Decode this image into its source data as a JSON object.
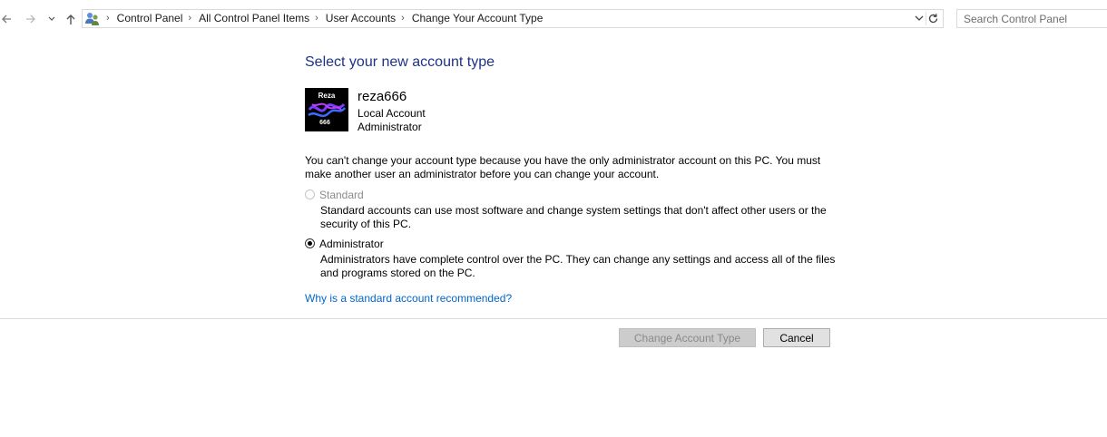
{
  "navigation": {
    "breadcrumbs": [
      "Control Panel",
      "All Control Panel Items",
      "User Accounts",
      "Change Your Account Type"
    ],
    "search": {
      "placeholder": "Search Control Panel",
      "value": ""
    }
  },
  "page": {
    "title": "Select your new account type",
    "account": {
      "name": "reza666",
      "type": "Local Account",
      "role": "Administrator",
      "avatar_text_top": "Reza",
      "avatar_text_bottom": "666"
    },
    "info": "You can't change your account type because you have the only administrator account on this PC. You must make another user an administrator before you can change your account.",
    "options": [
      {
        "label": "Standard",
        "description": "Standard accounts can use most software and change system settings that don't affect other users or the security of this PC.",
        "selected": false,
        "disabled": true
      },
      {
        "label": "Administrator",
        "description": "Administrators have complete control over the PC. They can change any settings and access all of the files and programs stored on the PC.",
        "selected": true,
        "disabled": false
      }
    ],
    "help_link": "Why is a standard account recommended?"
  },
  "buttons": {
    "change_label": "Change Account Type",
    "cancel_label": "Cancel"
  },
  "icons": {
    "back": "back-arrow-icon",
    "forward": "forward-arrow-icon",
    "recent": "chevron-down-icon",
    "up": "up-arrow-icon",
    "location": "user-accounts-icon",
    "refresh": "refresh-icon"
  },
  "colors": {
    "title": "#1e3287",
    "link": "#0066cc",
    "disabled_text": "#8a8a8a",
    "disabled_button": "#cccccc"
  }
}
